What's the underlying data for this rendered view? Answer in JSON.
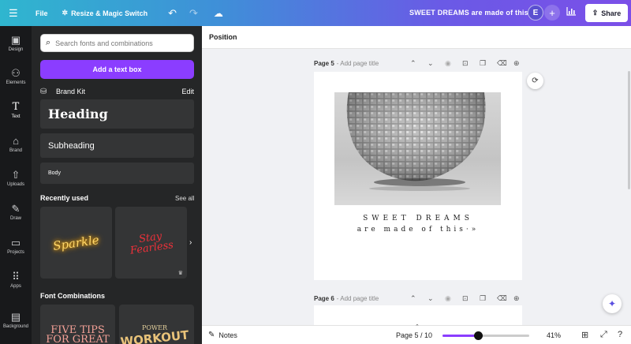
{
  "topbar": {
    "menu_icon": "hamburger-icon",
    "file_label": "File",
    "resize_label": "Resize & Magic Switch",
    "doc_title": "SWEET DREAMS are made of this",
    "avatar_letter": "E",
    "share_label": "Share",
    "gradient": [
      "#2fb6cf",
      "#7b4fe8"
    ]
  },
  "rail": {
    "items": [
      {
        "label": "Design",
        "icon": "design-icon"
      },
      {
        "label": "Elements",
        "icon": "elements-icon"
      },
      {
        "label": "Text",
        "icon": "text-icon"
      },
      {
        "label": "Brand",
        "icon": "brand-icon"
      },
      {
        "label": "Uploads",
        "icon": "upload-icon"
      },
      {
        "label": "Draw",
        "icon": "draw-icon"
      },
      {
        "label": "Projects",
        "icon": "folder-icon"
      },
      {
        "label": "Apps",
        "icon": "apps-icon"
      },
      {
        "label": "Background",
        "icon": "background-icon"
      }
    ],
    "active": "Text"
  },
  "panel": {
    "search_placeholder": "Search fonts and combinations",
    "add_text_label": "Add a text box",
    "brand_kit_label": "Brand Kit",
    "edit_label": "Edit",
    "heading_label": "Heading",
    "subheading_label": "Subheading",
    "body_label": "Body",
    "recently_used_label": "Recently used",
    "see_all_label": "See all",
    "recent": [
      {
        "text": "Sparkle"
      },
      {
        "line1": "Stay",
        "line2": "Fearless"
      }
    ],
    "font_combinations_label": "Font Combinations",
    "combos": [
      {
        "line1": "FIVE TIPS",
        "line2": "FOR GREAT"
      },
      {
        "line1": "POWER",
        "line2": "WORKOUT"
      }
    ],
    "accent_color": "#8b3dff"
  },
  "editor": {
    "position_label": "Position",
    "page5": {
      "number": "Page 5",
      "title_placeholder": "- Add page title"
    },
    "page6": {
      "number": "Page 6",
      "title_placeholder": "- Add page title"
    },
    "caption_line1": "SWEET DREAMS",
    "caption_line2": "are made of this·»"
  },
  "bottombar": {
    "notes_label": "Notes",
    "page_indicator": "Page 5 / 10",
    "zoom_label": "41%",
    "zoom_level": 0.41
  }
}
